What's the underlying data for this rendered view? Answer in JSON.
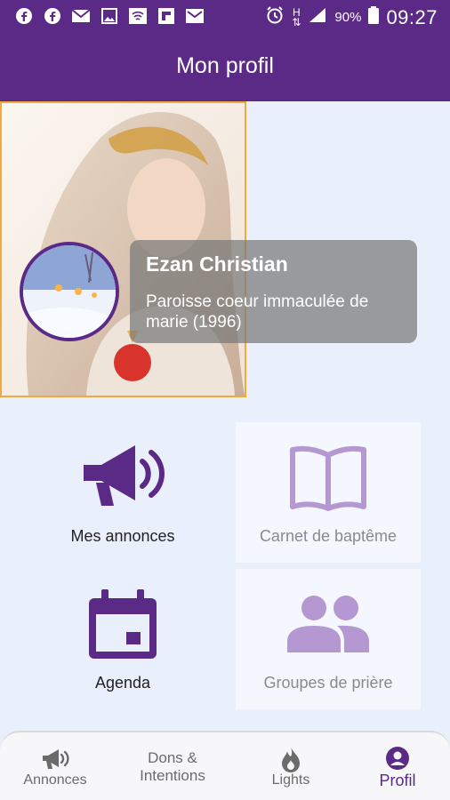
{
  "status_bar": {
    "icons": [
      "facebook-icon",
      "facebook-icon",
      "mail-icon",
      "image-icon",
      "wifi-icon",
      "flipboard-icon",
      "gmail-icon",
      "alarm-icon",
      "h-signal-icon",
      "signal-icon",
      "battery-icon"
    ],
    "battery": "90%",
    "time": "09:27"
  },
  "app_bar": {
    "title": "Mon profil"
  },
  "profile": {
    "name": "Ezan Christian",
    "parish": "Paroisse coeur immaculée de marie (1996)"
  },
  "tiles": [
    {
      "label": "Mes annonces",
      "icon": "megaphone-icon",
      "enabled": true
    },
    {
      "label": "Carnet de baptême",
      "icon": "book-icon",
      "enabled": false
    },
    {
      "label": "Agenda",
      "icon": "calendar-icon",
      "enabled": true
    },
    {
      "label": "Groupes de prière",
      "icon": "group-icon",
      "enabled": false
    }
  ],
  "bottom_nav": {
    "tabs": [
      {
        "label": "Annonces",
        "icon": "megaphone-icon"
      },
      {
        "label": "Dons &\nIntentions",
        "icon": ""
      },
      {
        "label": "Lights",
        "icon": "flame-icon"
      },
      {
        "label": "Profil",
        "icon": "user-circle-icon"
      }
    ],
    "active": "Profil"
  },
  "colors": {
    "primary": "#5b2a86",
    "tile_icon_active": "#5b2a86",
    "tile_icon_disabled": "#b598d2",
    "background": "#e9effb",
    "cover_border": "#f3a93b"
  }
}
